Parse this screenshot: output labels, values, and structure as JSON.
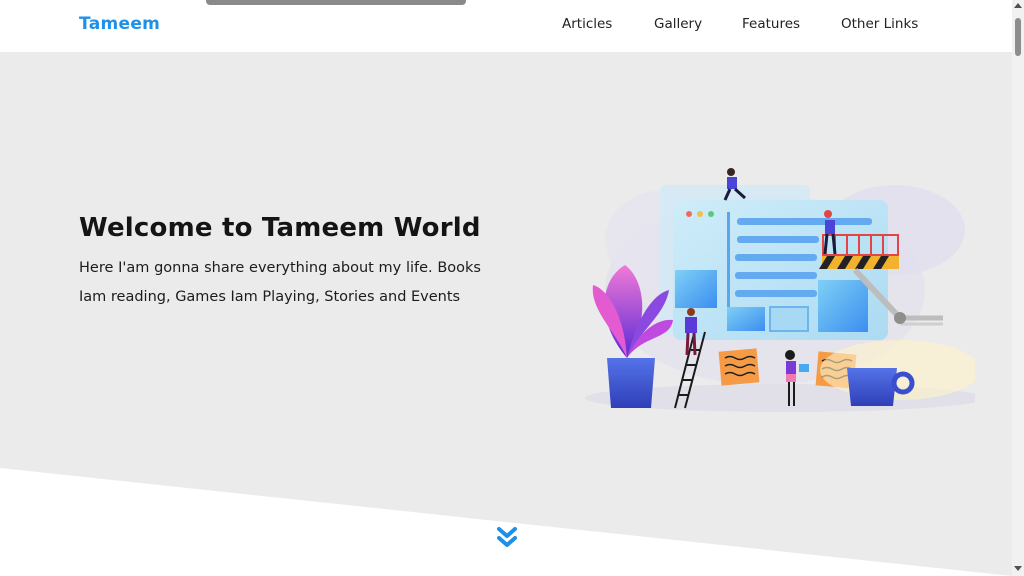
{
  "header": {
    "logo": "Tameem",
    "nav": [
      "Articles",
      "Gallery",
      "Features",
      "Other Links"
    ]
  },
  "hero": {
    "title": "Welcome to Tameem World",
    "text": "Here I'am gonna share everything about my life. Books Iam reading, Games Iam Playing, Stories and Events"
  },
  "icons": {
    "scroll_down": "double-chevron-down-icon",
    "illustration": "team-building-website-illustration"
  },
  "colors": {
    "brand": "#1e90e8",
    "hero_bg": "#ebebeb",
    "text": "#141414"
  }
}
